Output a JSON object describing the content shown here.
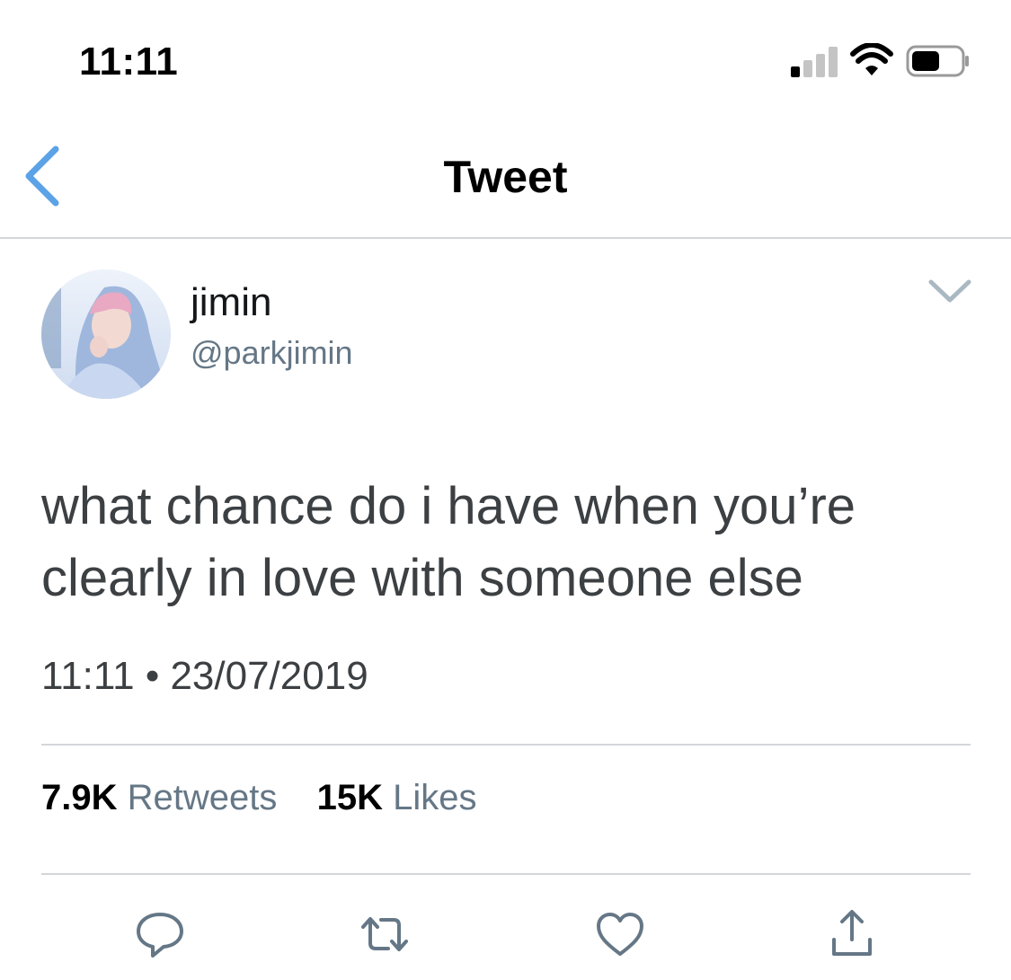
{
  "status_bar": {
    "time": "11:11"
  },
  "header": {
    "title": "Tweet",
    "back_icon": "chevron-left-icon"
  },
  "tweet": {
    "author_name": "jimin",
    "author_handle": "@parkjimin",
    "text": "what chance do i have when you’re clearly in love with someone else",
    "time": "11:11",
    "separator": "•",
    "date": "23/07/2019",
    "retweet_count": "7.9K",
    "retweet_label": "Retweets",
    "like_count": "15K",
    "like_label": "Likes"
  },
  "actions": [
    {
      "name": "reply",
      "icon": "reply-icon"
    },
    {
      "name": "retweet",
      "icon": "retweet-icon"
    },
    {
      "name": "like",
      "icon": "heart-icon"
    },
    {
      "name": "share",
      "icon": "share-icon"
    }
  ],
  "colors": {
    "accent": "#5ba2e6",
    "secondary_text": "#657786",
    "body_text": "#3c4043",
    "divider": "#d3d6d9"
  }
}
